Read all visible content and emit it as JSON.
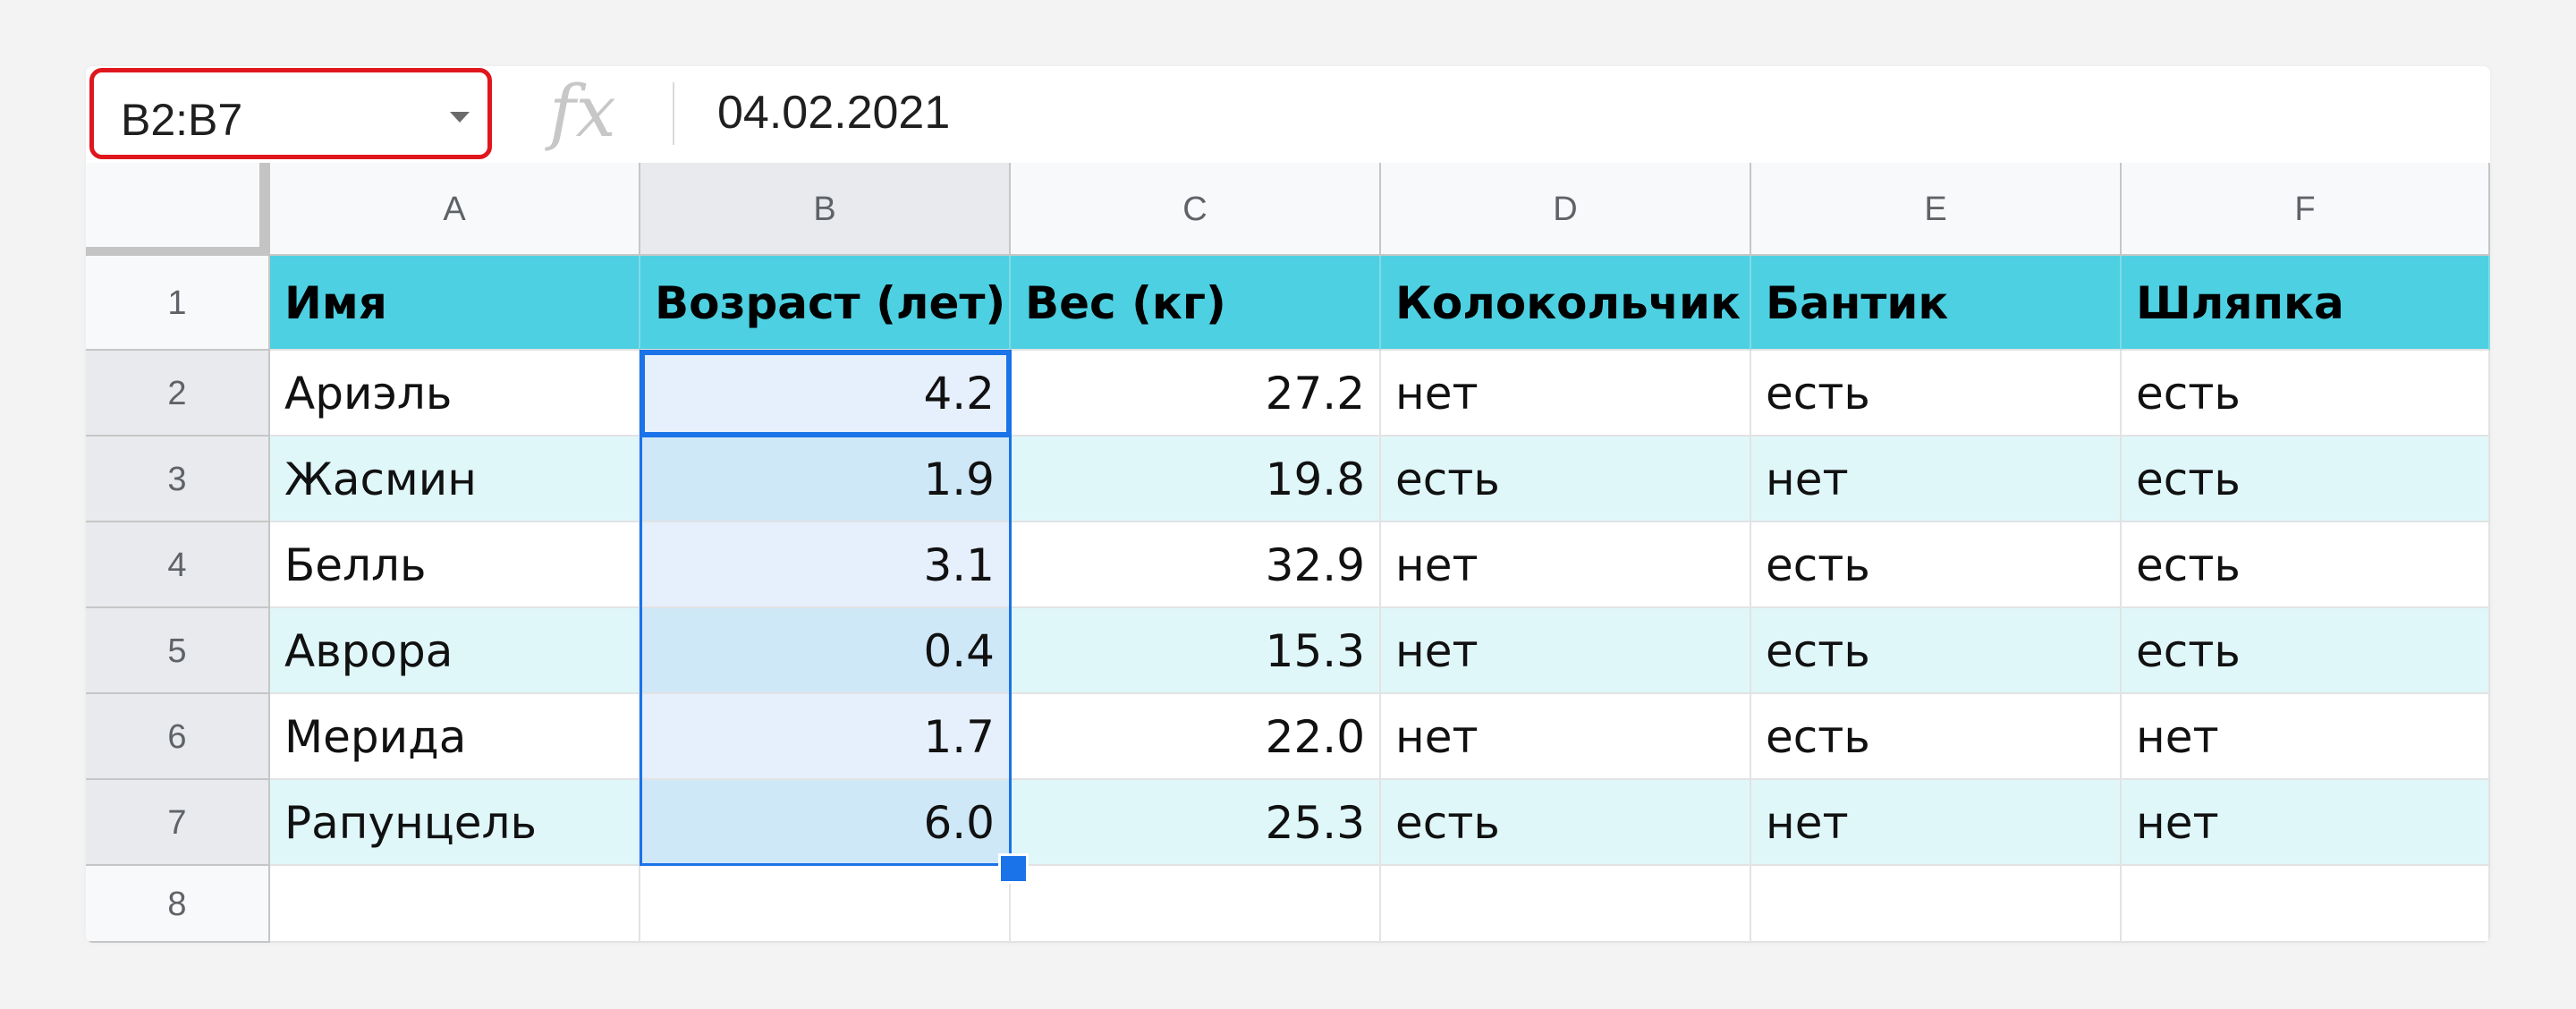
{
  "formula_bar": {
    "name_box": "B2:B7",
    "fx": "fx",
    "value": "04.02.2021"
  },
  "columns": [
    "A",
    "B",
    "C",
    "D",
    "E",
    "F"
  ],
  "rows": [
    "1",
    "2",
    "3",
    "4",
    "5",
    "6",
    "7",
    "8"
  ],
  "header_row": [
    "Имя",
    "Возраст (лет)",
    "Вес (кг)",
    "Колокольчик",
    "Бантик",
    "Шляпка"
  ],
  "data_rows": [
    [
      "Ариэль",
      "4.2",
      "27.2",
      "нет",
      "есть",
      "есть"
    ],
    [
      "Жасмин",
      "1.9",
      "19.8",
      "есть",
      "нет",
      "есть"
    ],
    [
      "Белль",
      "3.1",
      "32.9",
      "нет",
      "есть",
      "есть"
    ],
    [
      "Аврора",
      "0.4",
      "15.3",
      "нет",
      "есть",
      "есть"
    ],
    [
      "Мерида",
      "1.7",
      "22.0",
      "нет",
      "есть",
      "нет"
    ],
    [
      "Рапунцель",
      "6.0",
      "25.3",
      "есть",
      "нет",
      "нет"
    ]
  ],
  "selection": "B2:B7",
  "colors": {
    "header_fill": "#4dd0e1",
    "band_fill": "#e0f7fa",
    "selection_border": "#1a73e8",
    "selection_fill": "#d2e3fc",
    "name_box_highlight": "#e0161d"
  }
}
